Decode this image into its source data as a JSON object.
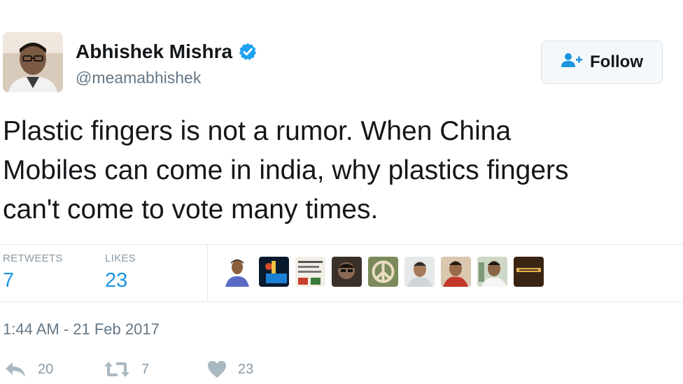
{
  "user": {
    "display_name": "Abhishek Mishra",
    "handle": "@meamabhishek",
    "verified": true,
    "avatar_icon": "profile-photo"
  },
  "follow_button": {
    "label": "Follow",
    "icon": "add-user-icon"
  },
  "tweet": {
    "lines": [
      "Plastic fingers is not a rumor. When China",
      "Mobiles can come in india, why plastics fingers",
      "can't come to vote many times."
    ]
  },
  "stats": {
    "retweets_label": "RETWEETS",
    "retweets_count": "7",
    "likes_label": "LIKES",
    "likes_count": "23"
  },
  "timestamp": "1:44 AM - 21 Feb 2017",
  "actions": {
    "reply_count": "20",
    "retweet_count": "7",
    "like_count": "23"
  },
  "colors": {
    "link_blue": "#1b95e0",
    "verified_blue": "#1da1f2",
    "muted_gray": "#657786",
    "text": "#14171a"
  }
}
